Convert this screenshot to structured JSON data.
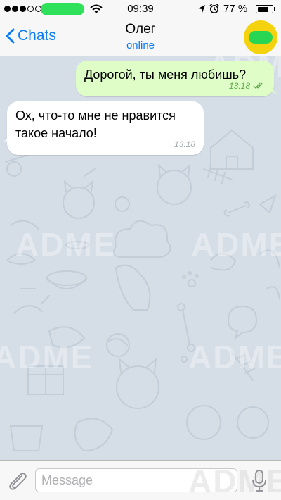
{
  "status_bar": {
    "time": "09:39",
    "battery_percent": "77 %",
    "signal_strength": 3,
    "battery_level": 0.77,
    "icons": [
      "signal-dots-icon",
      "wifi-icon",
      "location-arrow-icon",
      "alarm-clock-icon",
      "battery-icon"
    ]
  },
  "nav": {
    "back_label": "Chats",
    "title": "Олег",
    "subtitle": "online",
    "accent_color": "#0a7cf5",
    "avatar_color": "#f5d20e"
  },
  "messages": [
    {
      "direction": "outgoing",
      "text": "Дорогой, ты меня любишь?",
      "time": "13:18",
      "status_icon": "double-check-icon",
      "bubble_color": "#dffec7"
    },
    {
      "direction": "incoming",
      "text": "Ох, что-то мне не нравится такое начало!",
      "time": "13:18",
      "bubble_color": "#ffffff"
    }
  ],
  "composer": {
    "placeholder": "Message",
    "value": "",
    "attach_icon": "paperclip-icon",
    "mic_icon": "microphone-icon"
  },
  "watermark": "ADME",
  "chat_background_color": "#d5dde6"
}
